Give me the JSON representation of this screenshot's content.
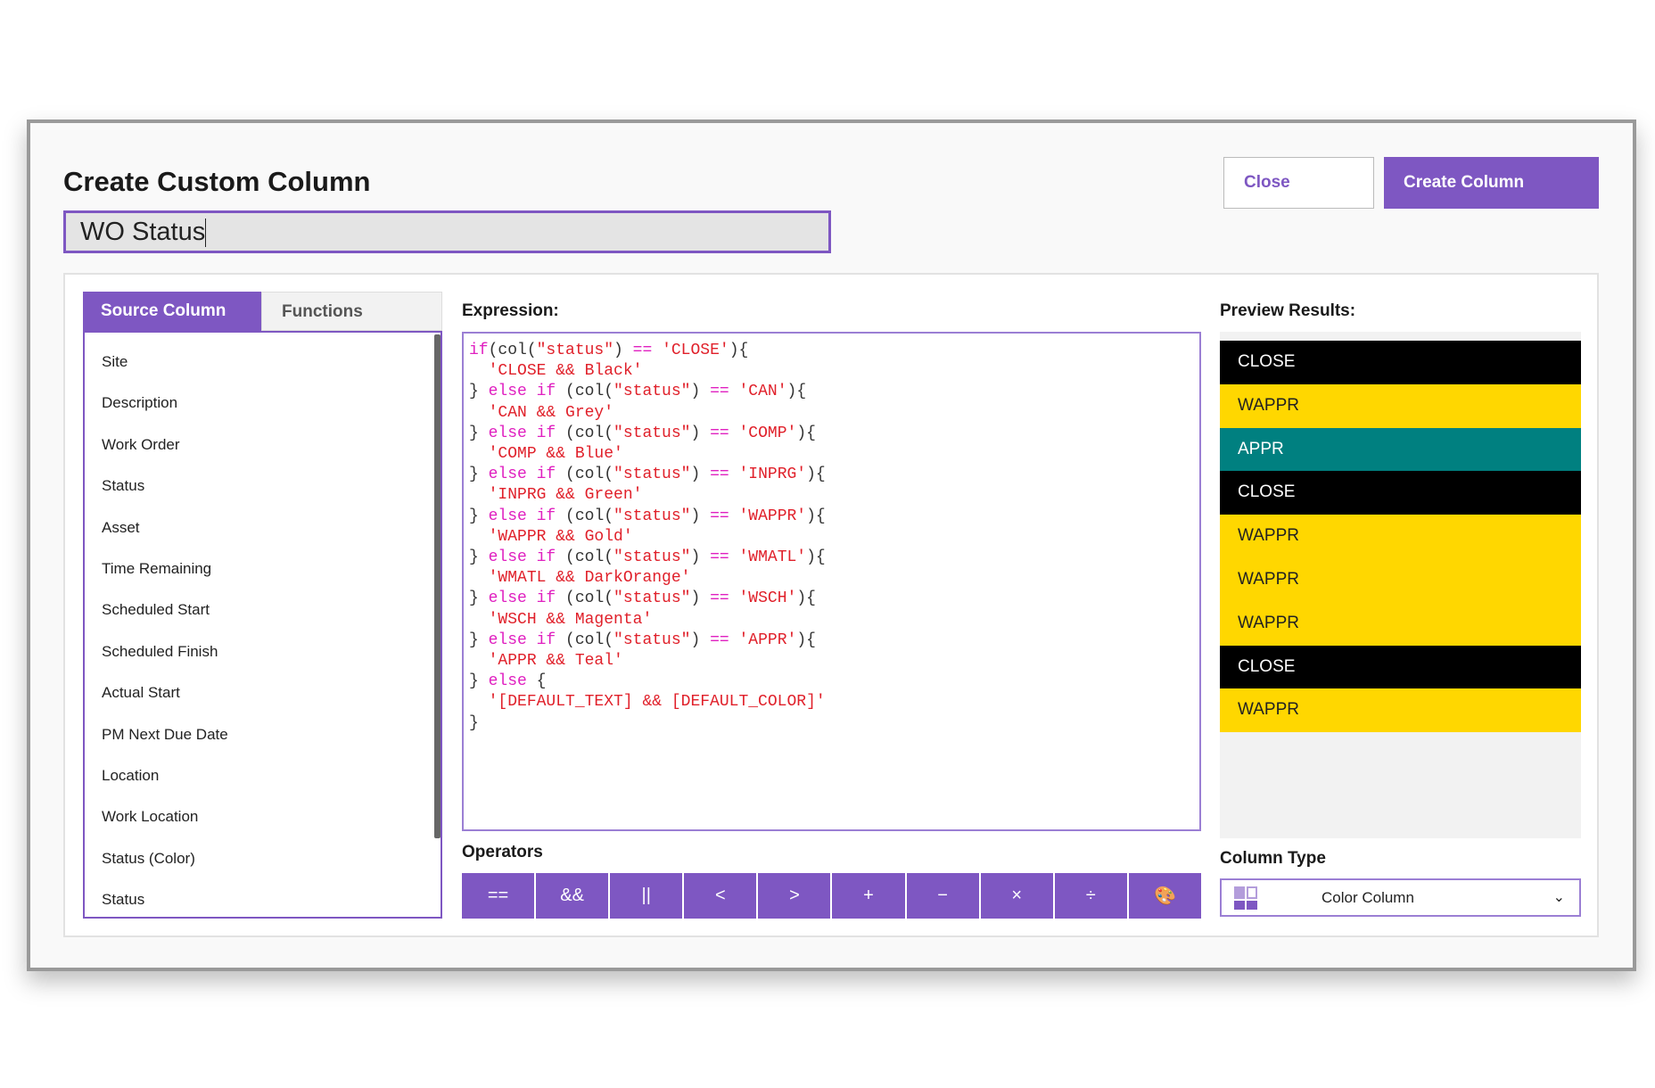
{
  "dialog": {
    "title": "Create Custom Column",
    "name_value": "WO Status",
    "close_label": "Close",
    "create_label": "Create Column"
  },
  "tabs": [
    {
      "label": "Source Column"
    },
    {
      "label": "Functions"
    }
  ],
  "source_columns": [
    "Site",
    "Description",
    "Work Order",
    "Status",
    "Asset",
    "Time Remaining",
    "Scheduled Start",
    "Scheduled Finish",
    "Actual Start",
    "PM Next Due Date",
    "Location",
    "Work Location",
    "Status (Color)",
    "Status"
  ],
  "expression": {
    "label": "Expression:",
    "lines": [
      [
        [
          "kw",
          "if"
        ],
        [
          "",
          "(col("
        ],
        [
          "str",
          "\"status\""
        ],
        [
          "",
          ") "
        ],
        [
          "kw",
          "=="
        ],
        [
          "",
          " "
        ],
        [
          "str",
          "'CLOSE'"
        ],
        [
          "",
          "){"
        ]
      ],
      [
        [
          "",
          "  "
        ],
        [
          "str",
          "'CLOSE && Black'"
        ]
      ],
      [
        [
          "",
          "} "
        ],
        [
          "kw",
          "else if"
        ],
        [
          "",
          " (col("
        ],
        [
          "str",
          "\"status\""
        ],
        [
          "",
          ") "
        ],
        [
          "kw",
          "=="
        ],
        [
          "",
          " "
        ],
        [
          "str",
          "'CAN'"
        ],
        [
          "",
          "){"
        ]
      ],
      [
        [
          "",
          "  "
        ],
        [
          "str",
          "'CAN && Grey'"
        ]
      ],
      [
        [
          "",
          "} "
        ],
        [
          "kw",
          "else if"
        ],
        [
          "",
          " (col("
        ],
        [
          "str",
          "\"status\""
        ],
        [
          "",
          ") "
        ],
        [
          "kw",
          "=="
        ],
        [
          "",
          " "
        ],
        [
          "str",
          "'COMP'"
        ],
        [
          "",
          "){"
        ]
      ],
      [
        [
          "",
          "  "
        ],
        [
          "str",
          "'COMP && Blue'"
        ]
      ],
      [
        [
          "",
          "} "
        ],
        [
          "kw",
          "else if"
        ],
        [
          "",
          " (col("
        ],
        [
          "str",
          "\"status\""
        ],
        [
          "",
          ") "
        ],
        [
          "kw",
          "=="
        ],
        [
          "",
          " "
        ],
        [
          "str",
          "'INPRG'"
        ],
        [
          "",
          "){"
        ]
      ],
      [
        [
          "",
          "  "
        ],
        [
          "str",
          "'INPRG && Green'"
        ]
      ],
      [
        [
          "",
          "} "
        ],
        [
          "kw",
          "else if"
        ],
        [
          "",
          " (col("
        ],
        [
          "str",
          "\"status\""
        ],
        [
          "",
          ") "
        ],
        [
          "kw",
          "=="
        ],
        [
          "",
          " "
        ],
        [
          "str",
          "'WAPPR'"
        ],
        [
          "",
          "){"
        ]
      ],
      [
        [
          "",
          "  "
        ],
        [
          "str",
          "'WAPPR && Gold'"
        ]
      ],
      [
        [
          "",
          "} "
        ],
        [
          "kw",
          "else if"
        ],
        [
          "",
          " (col("
        ],
        [
          "str",
          "\"status\""
        ],
        [
          "",
          ") "
        ],
        [
          "kw",
          "=="
        ],
        [
          "",
          " "
        ],
        [
          "str",
          "'WMATL'"
        ],
        [
          "",
          "){"
        ]
      ],
      [
        [
          "",
          "  "
        ],
        [
          "str",
          "'WMATL && DarkOrange'"
        ]
      ],
      [
        [
          "",
          "} "
        ],
        [
          "kw",
          "else if"
        ],
        [
          "",
          " (col("
        ],
        [
          "str",
          "\"status\""
        ],
        [
          "",
          ") "
        ],
        [
          "kw",
          "=="
        ],
        [
          "",
          " "
        ],
        [
          "str",
          "'WSCH'"
        ],
        [
          "",
          "){"
        ]
      ],
      [
        [
          "",
          "  "
        ],
        [
          "str",
          "'WSCH && Magenta'"
        ]
      ],
      [
        [
          "",
          "} "
        ],
        [
          "kw",
          "else if"
        ],
        [
          "",
          " (col("
        ],
        [
          "str",
          "\"status\""
        ],
        [
          "",
          ") "
        ],
        [
          "kw",
          "=="
        ],
        [
          "",
          " "
        ],
        [
          "str",
          "'APPR'"
        ],
        [
          "",
          "){"
        ]
      ],
      [
        [
          "",
          "  "
        ],
        [
          "str",
          "'APPR && Teal'"
        ]
      ],
      [
        [
          "",
          "} "
        ],
        [
          "kw",
          "else"
        ],
        [
          "",
          " {"
        ]
      ],
      [
        [
          "",
          "  "
        ],
        [
          "str",
          "'[DEFAULT_TEXT] && [DEFAULT_COLOR]'"
        ]
      ],
      [
        [
          "",
          "}"
        ]
      ]
    ]
  },
  "operators": {
    "label": "Operators",
    "buttons": [
      {
        "label": "==",
        "name": "equals"
      },
      {
        "label": "&&",
        "name": "and"
      },
      {
        "label": "||",
        "name": "or"
      },
      {
        "label": "<",
        "name": "less-than"
      },
      {
        "label": ">",
        "name": "greater-than"
      },
      {
        "label": "+",
        "name": "plus"
      },
      {
        "label": "−",
        "name": "minus"
      },
      {
        "label": "×",
        "name": "multiply"
      },
      {
        "label": "÷",
        "name": "divide"
      },
      {
        "label": "🎨",
        "name": "color-palette",
        "icon": "palette-icon"
      }
    ]
  },
  "preview": {
    "label": "Preview Results:",
    "rows": [
      {
        "text": "CLOSE",
        "bg": "#000000",
        "fg": "#ffffff"
      },
      {
        "text": "WAPPR",
        "bg": "#ffd700",
        "fg": "#222222"
      },
      {
        "text": "APPR",
        "bg": "#008080",
        "fg": "#ffffff"
      },
      {
        "text": "CLOSE",
        "bg": "#000000",
        "fg": "#ffffff"
      },
      {
        "text": "WAPPR",
        "bg": "#ffd700",
        "fg": "#222222"
      },
      {
        "text": "WAPPR",
        "bg": "#ffd700",
        "fg": "#222222"
      },
      {
        "text": "WAPPR",
        "bg": "#ffd700",
        "fg": "#222222"
      },
      {
        "text": "CLOSE",
        "bg": "#000000",
        "fg": "#ffffff"
      },
      {
        "text": "WAPPR",
        "bg": "#ffd700",
        "fg": "#222222"
      }
    ]
  },
  "column_type": {
    "label": "Column Type",
    "selected": "Color Column",
    "icon": "color-grid-icon"
  },
  "colors": {
    "accent": "#7e57c2"
  }
}
